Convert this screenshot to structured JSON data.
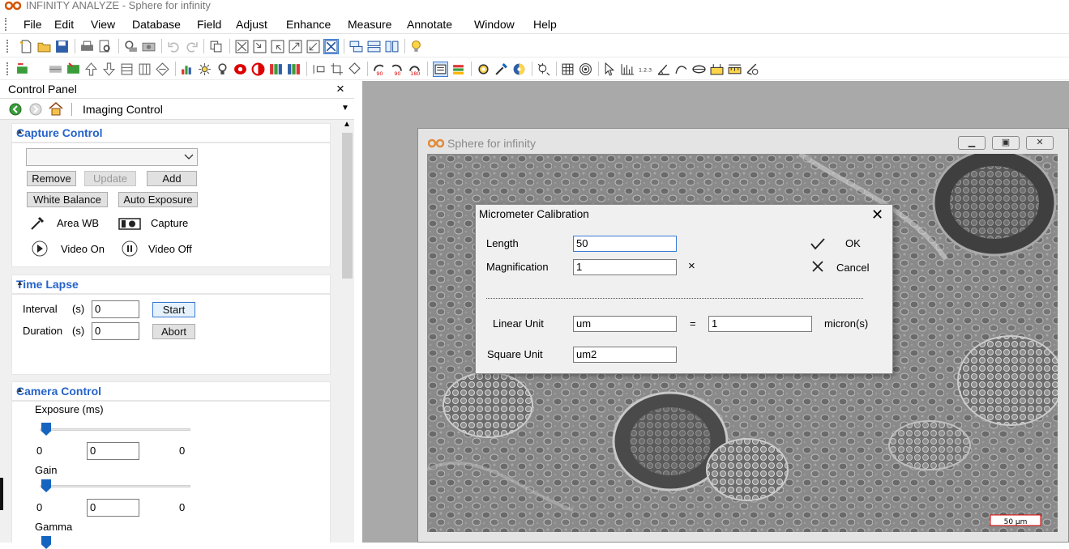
{
  "window": {
    "title": "INFINITY ANALYZE - Sphere for infinity"
  },
  "menu": [
    "File",
    "Edit",
    "View",
    "Database",
    "Field",
    "Adjust",
    "Enhance",
    "Measure",
    "Annotate",
    "Window",
    "Help"
  ],
  "control_panel": {
    "title": "Control Panel",
    "close": "×",
    "nav_label": "Imaging Control",
    "capture": {
      "header": "Capture Control",
      "remove": "Remove",
      "update": "Update",
      "add": "Add",
      "white_balance": "White Balance",
      "auto_exposure": "Auto Exposure",
      "area_wb": "Area WB",
      "capture": "Capture",
      "video_on": "Video On",
      "video_off": "Video Off"
    },
    "time_lapse": {
      "header": "Time Lapse",
      "interval_label": "Interval",
      "duration_label": "Duration",
      "unit": "(s)",
      "interval_value": "0",
      "duration_value": "0",
      "start": "Start",
      "abort": "Abort"
    },
    "camera": {
      "header": "Camera Control",
      "exposure_label": "Exposure (ms)",
      "exposure_min": "0",
      "exposure_value": "0",
      "exposure_max": "0",
      "gain_label": "Gain",
      "gain_min": "0",
      "gain_value": "0",
      "gain_max": "0",
      "gamma_label": "Gamma"
    }
  },
  "image_window": {
    "title": "Sphere for infinity",
    "scale_bar": "50 µm"
  },
  "dialog": {
    "title": "Micrometer Calibration",
    "length_label": "Length",
    "length_value": "50",
    "magnification_label": "Magnification",
    "magnification_value": "1",
    "times": "×",
    "ok": "OK",
    "cancel": "Cancel",
    "linear_unit_label": "Linear Unit",
    "linear_unit_value": "um",
    "equals": "=",
    "linear_factor": "1",
    "micron_label": "micron(s)",
    "square_unit_label": "Square Unit",
    "square_unit_value": "um2"
  },
  "colors": {
    "accent": "#2563c9",
    "slider": "#1565c0",
    "workspace": "#a9a9a9"
  }
}
